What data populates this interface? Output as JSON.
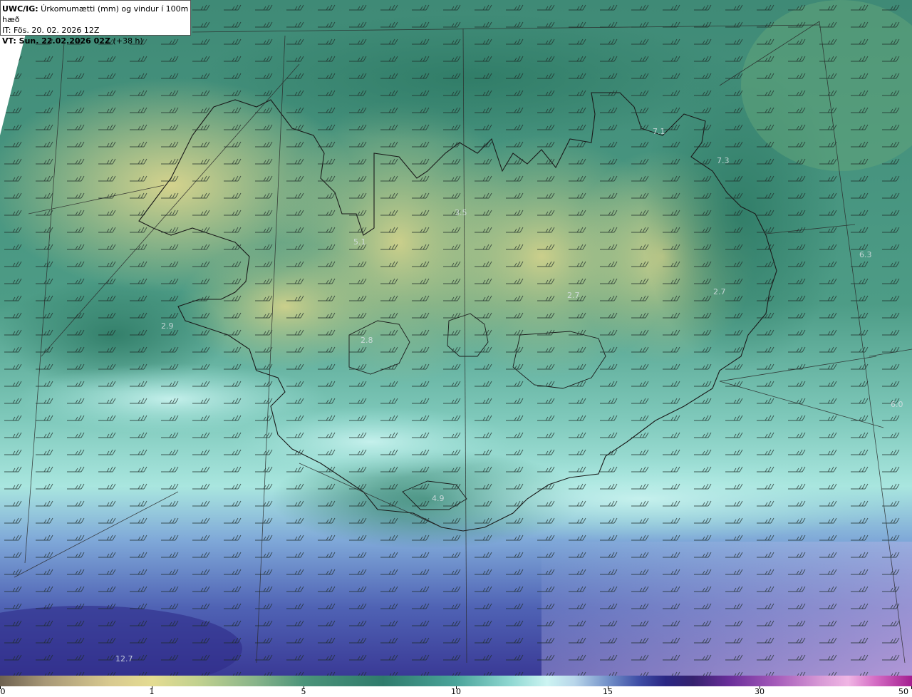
{
  "header": {
    "model_prefix": "UWC/IG:",
    "title": " Úrkomumætti (mm) og vindur í 100m hæð",
    "it_line": "IT: Fös. 20. 02. 2026 12Z",
    "vt_prefix": "VT: Sun. 22.02.2026 02Z",
    "vt_suffix": " (+38 h)"
  },
  "map_values": [
    "7.1",
    "7.3",
    "5.1",
    "6.3",
    "2.7",
    "2.9",
    "2.8",
    "2.7",
    "6.0",
    "4.9",
    "12.7",
    "3.5"
  ],
  "colorbar": {
    "ticks": [
      "0",
      "1",
      "5",
      "10",
      "15",
      "30",
      "50"
    ]
  }
}
